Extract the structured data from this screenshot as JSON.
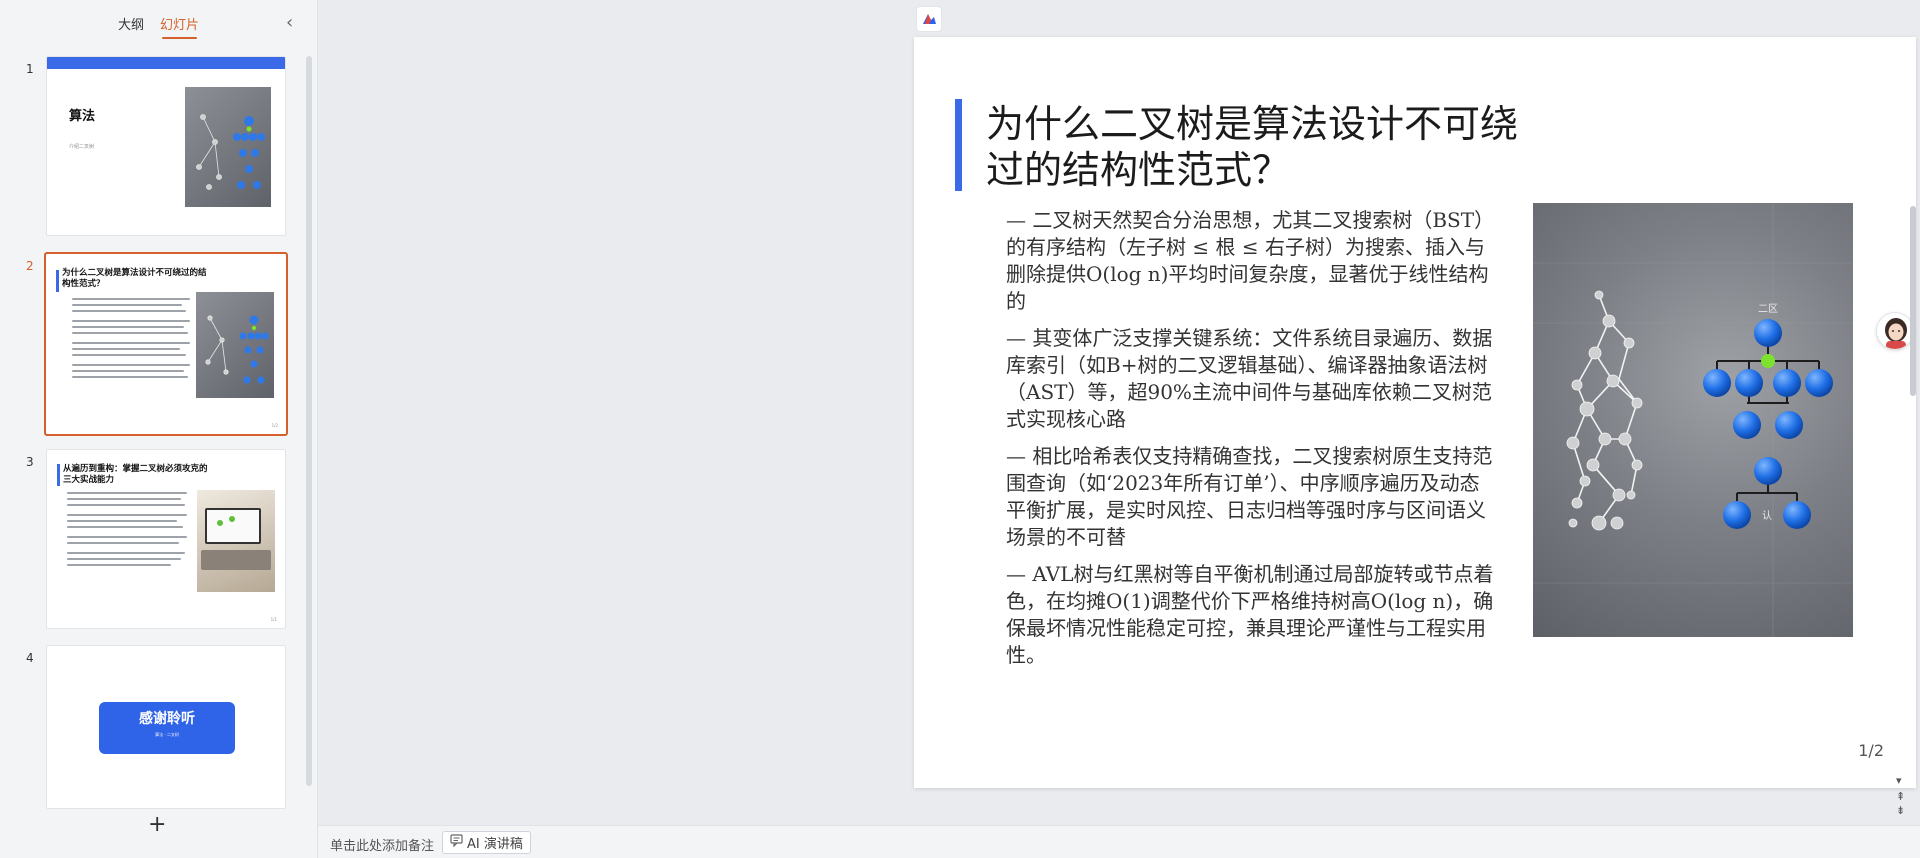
{
  "left_panel": {
    "tabs": [
      {
        "label": "大纲",
        "active": false
      },
      {
        "label": "幻灯片",
        "active": true
      }
    ],
    "collapse_icon": "chevron-left-icon",
    "add_icon": "plus-icon",
    "thumbnails": [
      {
        "num": "1",
        "title": "算法",
        "subtitle": "介绍二叉树"
      },
      {
        "num": "2",
        "title": "为什么二叉树是算法设计不可绕过的结构性范式？",
        "page": "1/2"
      },
      {
        "num": "3",
        "title": "从遍历到重构：掌握二叉树必须攻克的三大实战能力",
        "page": "1/1"
      },
      {
        "num": "4",
        "title": "感谢聆听",
        "subtitle": "算法 · 二叉树"
      }
    ]
  },
  "slide": {
    "title": "为什么二叉树是算法设计不可绕过的结构性范式？",
    "bullets": [
      "— 二叉树天然契合分治思想，尤其二叉搜索树（BST）的有序结构（左子树 ≤ 根 ≤ 右子树）为搜索、插入与删除提供O(log n)平均时间复杂度，显著优于线性结构的",
      "— 其变体广泛支撑关键系统：文件系统目录遍历、数据库索引（如B+树的二叉逻辑基础）、编译器抽象语法树（AST）等，超90%主流中间件与基础库依赖二叉树范式实现核心路",
      "— 相比哈希表仅支持精确查找，二叉搜索树原生支持范围查询（如‘2023年所有订单’）、中序顺序遍历及动态平衡扩展，是实时风控、日志归档等强时序与区间语义场景的不可替",
      "— AVL树与红黑树等自平衡机制通过局部旋转或节点着色，在均摊O(1)调整代价下严格维持树高O(log n)，确保最坏情况性能稳定可控，兼具理论严谨性与工程实用性。"
    ],
    "page": "1/2",
    "image_labels": {
      "top": "二区",
      "bottom": "认"
    }
  },
  "notes_bar": {
    "placeholder": "单击此处添加备注",
    "ai_button": "AI 演讲稿"
  },
  "colors": {
    "accent": "#3a6ae8",
    "tab_active": "#d4612b"
  }
}
